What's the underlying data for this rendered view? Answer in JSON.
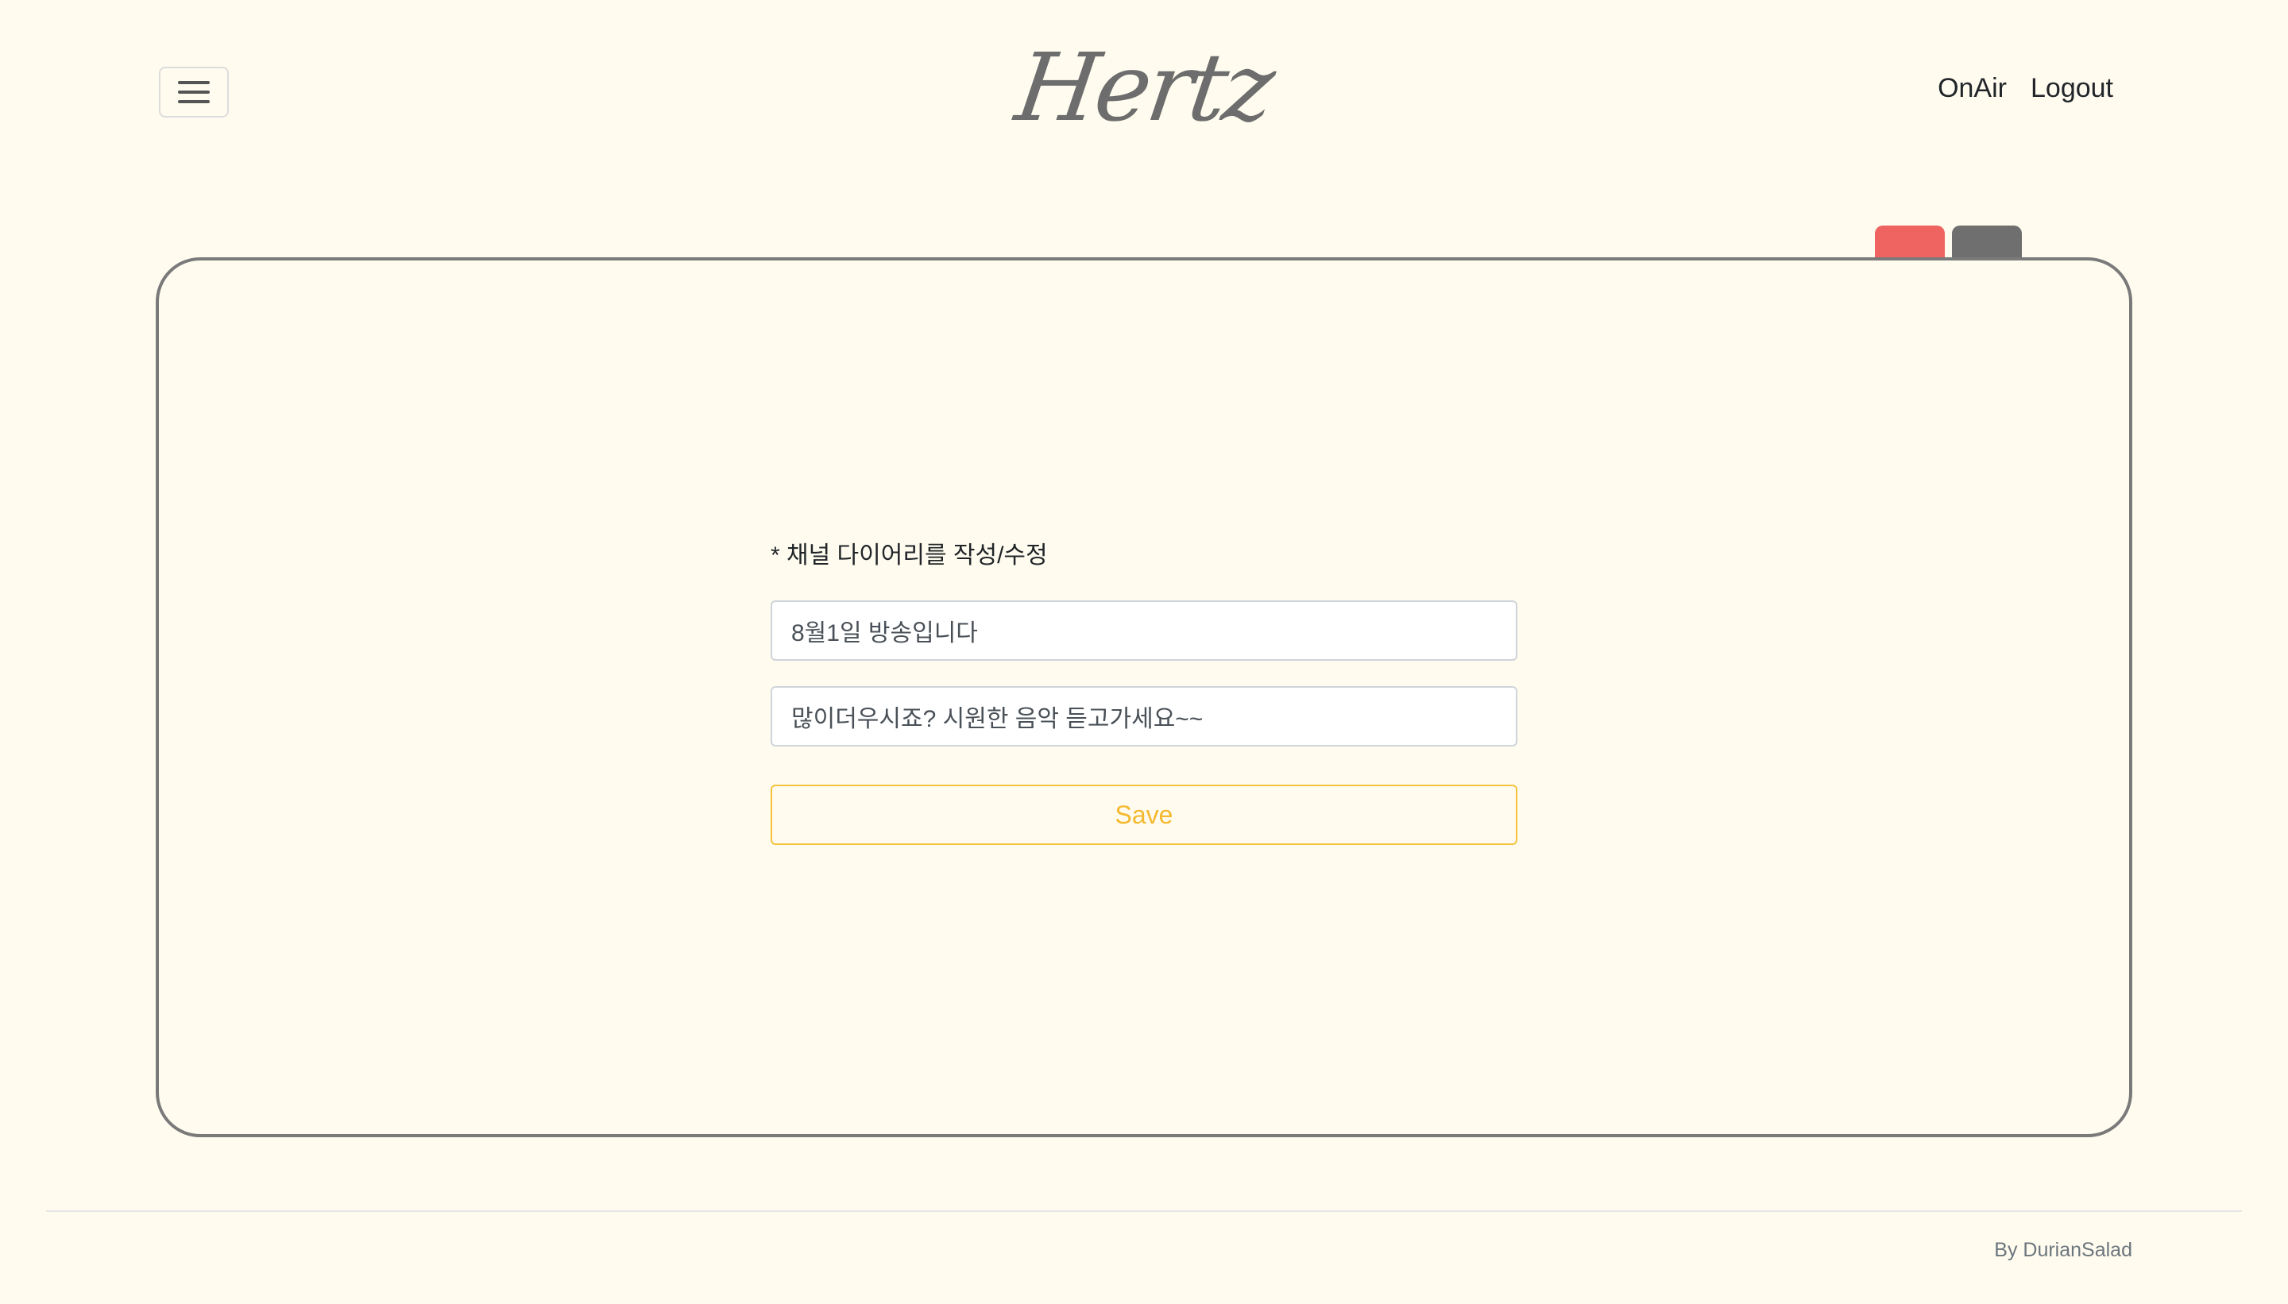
{
  "header": {
    "menu_icon": "hamburger-menu-icon",
    "logo_text": "Hertz",
    "nav": {
      "onair_label": "OnAir",
      "logout_label": "Logout"
    }
  },
  "tabs": {
    "colors": [
      "#ef6461",
      "#6f6f6f"
    ]
  },
  "form": {
    "label": "* 채널 다이어리를 작성/수정",
    "title_value": "8월1일 방송입니다",
    "content_value": "많이더우시죠? 시원한 음악 듣고가세요~~",
    "save_label": "Save"
  },
  "footer": {
    "credit": "By DurianSalad"
  },
  "colors": {
    "background": "#fffcef",
    "accent": "#f5b82e",
    "card_border": "#7a7a7a"
  }
}
